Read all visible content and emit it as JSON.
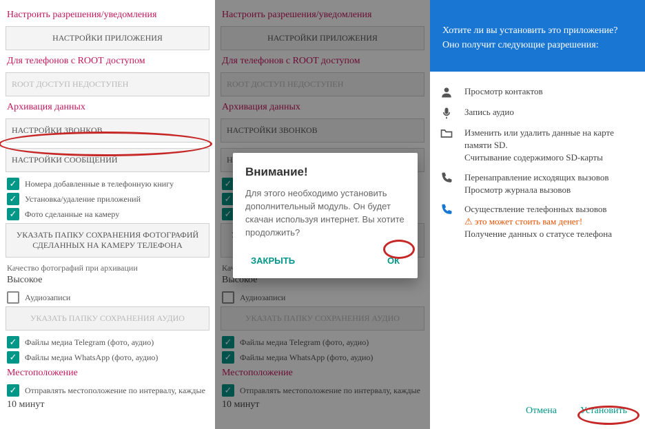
{
  "shared": {
    "section_perm": "Настроить разрешения/уведомления",
    "btn_app_settings": "НАСТРОЙКИ ПРИЛОЖЕНИЯ",
    "section_root": "Для телефонов с ROOT доступом",
    "root_status": "ROOT ДОСТУП НЕДОСТУПЕН",
    "section_archive": "Архивация данных",
    "btn_calls": "НАСТРОЙКИ ЗВОНКОВ",
    "btn_msgs": "НАСТРОЙКИ СООБЩЕНИЙ",
    "chk_contacts": "Номера добавленные в телефонную книгу",
    "chk_apps": "Установка/удаление приложений",
    "chk_camera": "Фото сделанные на камеру",
    "btn_photo_folder": "УКАЗАТЬ ПАПКУ СОХРАНЕНИЯ ФОТОГРАФИЙ СДЕЛАННЫХ НА КАМЕРУ ТЕЛЕФОНА",
    "label_quality": "Качество фотографий при архивации",
    "quality_value": "Высокое",
    "chk_audio": "Аудиозаписи",
    "btn_audio_folder": "УКАЗАТЬ ПАПКУ СОХРАНЕНИЯ АУДИО",
    "chk_telegram": "Файлы медиа Telegram (фото, аудио)",
    "chk_whatsapp": "Файлы медиа WhatsApp (фото, аудио)",
    "section_location": "Местоположение",
    "chk_location": "Отправлять местоположение по интервалу, каждые",
    "interval_value": "10 минут"
  },
  "dialog": {
    "title": "Внимание!",
    "body": "Для этого необходимо установить дополнительный модуль. Он будет скачан используя интернет. Вы хотите продолжить?",
    "close": "ЗАКРЫТЬ",
    "ok": "ОК"
  },
  "install": {
    "question": "Хотите ли вы установить это приложение? Оно получит следующие разрешения:",
    "perm_contacts": "Просмотр контактов",
    "perm_audio": "Запись аудио",
    "perm_sd1": "Изменить или удалить данные на карте памяти SD.",
    "perm_sd2": "Считывание содержимого SD-карты",
    "perm_calls1": "Перенаправление исходящих вызовов",
    "perm_calls2": "Просмотр журнала вызовов",
    "perm_phone1": "Осуществление телефонных вызовов",
    "perm_phone_warn": "это может стоить вам денег!",
    "perm_phone2": "Получение данных о статусе телефона",
    "cancel": "Отмена",
    "install_btn": "Установить"
  }
}
